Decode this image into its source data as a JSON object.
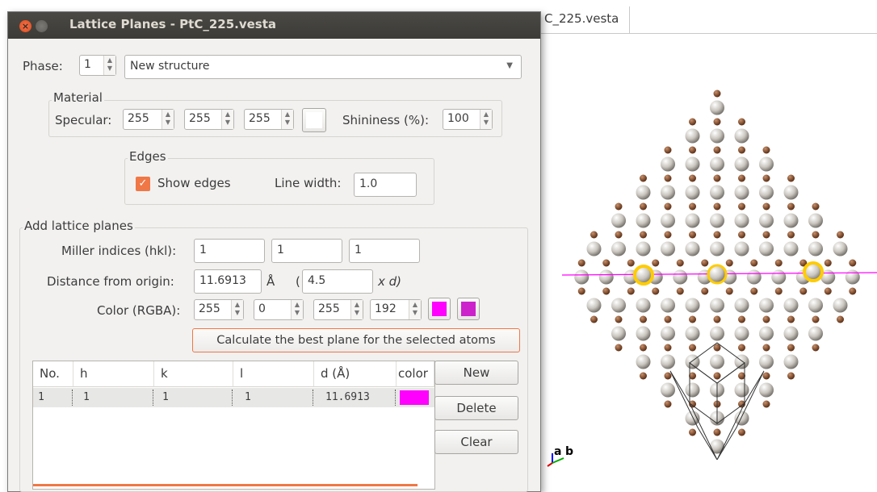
{
  "background": {
    "tab_label": "C_225.vesta",
    "axes": {
      "a": "a",
      "b": "b"
    }
  },
  "dialog": {
    "title": "Lattice Planes - PtC_225.vesta",
    "close_glyph": "×",
    "phase": {
      "label": "Phase:",
      "number": "1",
      "name": "New structure"
    },
    "material": {
      "title": "Material",
      "specular_label": "Specular:",
      "specular": [
        "255",
        "255",
        "255"
      ],
      "shininess_label": "Shininess (%):",
      "shininess": "100"
    },
    "edges": {
      "title": "Edges",
      "show_edges_label": "Show edges",
      "show_edges_checked": true,
      "line_width_label": "Line width:",
      "line_width": "1.0"
    },
    "add_planes": {
      "title": "Add lattice planes",
      "miller_label": "Miller indices (hkl):",
      "h": "1",
      "k": "1",
      "l": "1",
      "distance_label": "Distance from origin:",
      "distance": "11.6913",
      "distance_unit": "Å",
      "paren_open": "(",
      "multiple": "4.5",
      "multiple_suffix": "x d)",
      "color_label": "Color (RGBA):",
      "rgba": [
        "255",
        "0",
        "255",
        "192"
      ],
      "calc_button": "Calculate the best plane for the selected atoms"
    },
    "table": {
      "headers": [
        "No.",
        "h",
        "k",
        "l",
        "d (Å)",
        "color"
      ],
      "rows": [
        {
          "no": "1",
          "h": "1",
          "k": "1",
          "l": "1",
          "d": "11.6913",
          "color": "#ff00ff"
        }
      ]
    },
    "buttons": {
      "new": "New",
      "delete": "Delete",
      "clear": "Clear"
    }
  },
  "colors": {
    "accent": "#f07746",
    "magenta": "#ff00ff",
    "checkbox": "#f07746"
  }
}
